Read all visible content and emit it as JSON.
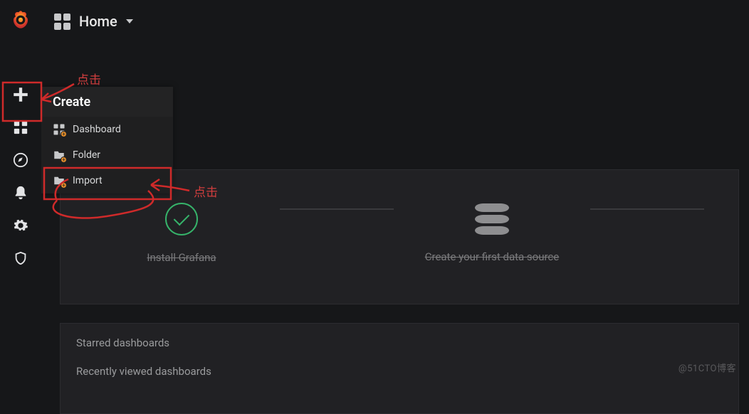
{
  "topbar": {
    "home_label": "Home"
  },
  "sidebar_flyout": {
    "header": "Create",
    "items": [
      {
        "label": "Dashboard"
      },
      {
        "label": "Folder"
      },
      {
        "label": "Import"
      }
    ]
  },
  "onboarding_steps": {
    "install_label": "Install Grafana",
    "datasource_label": "Create your first data source"
  },
  "starred_heading": "Starred dashboards",
  "recent_heading": "Recently viewed dashboards",
  "annotations": {
    "click_plus_label": "点击",
    "click_import_label": "点击"
  },
  "watermark": "@51CTO博客"
}
